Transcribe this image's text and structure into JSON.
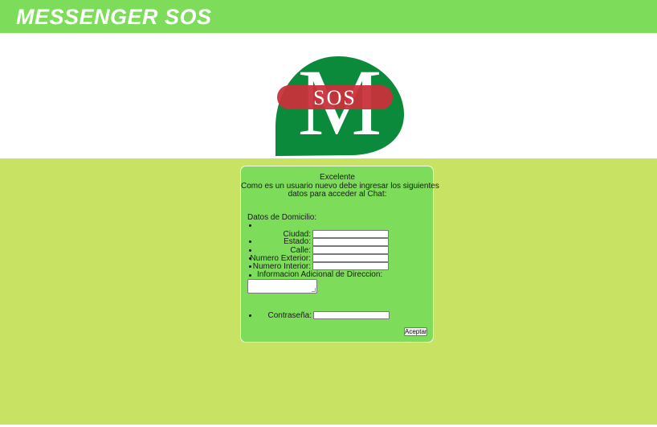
{
  "header": {
    "title": "MESSENGER SOS"
  },
  "logo": {
    "letter": "M",
    "badge": "SOS"
  },
  "form": {
    "heading": "Excelente",
    "intro_line1": "Como es un usuario nuevo debe ingresar los siguientes",
    "intro_line2": "datos para acceder al Chat:",
    "section": "Datos de Domicilio:",
    "fields": [
      {
        "label": "Ciudad:",
        "value": ""
      },
      {
        "label": "Estado:",
        "value": ""
      },
      {
        "label": "Calle:",
        "value": ""
      },
      {
        "label": "Numero Exterior:",
        "value": ""
      },
      {
        "label": "Numero Interior:",
        "value": ""
      }
    ],
    "additional_label": "Informacion Adicional de Direccion:",
    "additional_value": "",
    "password_label": "Contraseña:",
    "password_value": "",
    "submit_label": "Aceptar"
  },
  "colors": {
    "header_bg": "#7ddc5a",
    "page_bg": "#c8e264",
    "card_bg": "#7ddc5a",
    "logo_green": "#0a8a3a",
    "logo_red": "#c8323a"
  }
}
